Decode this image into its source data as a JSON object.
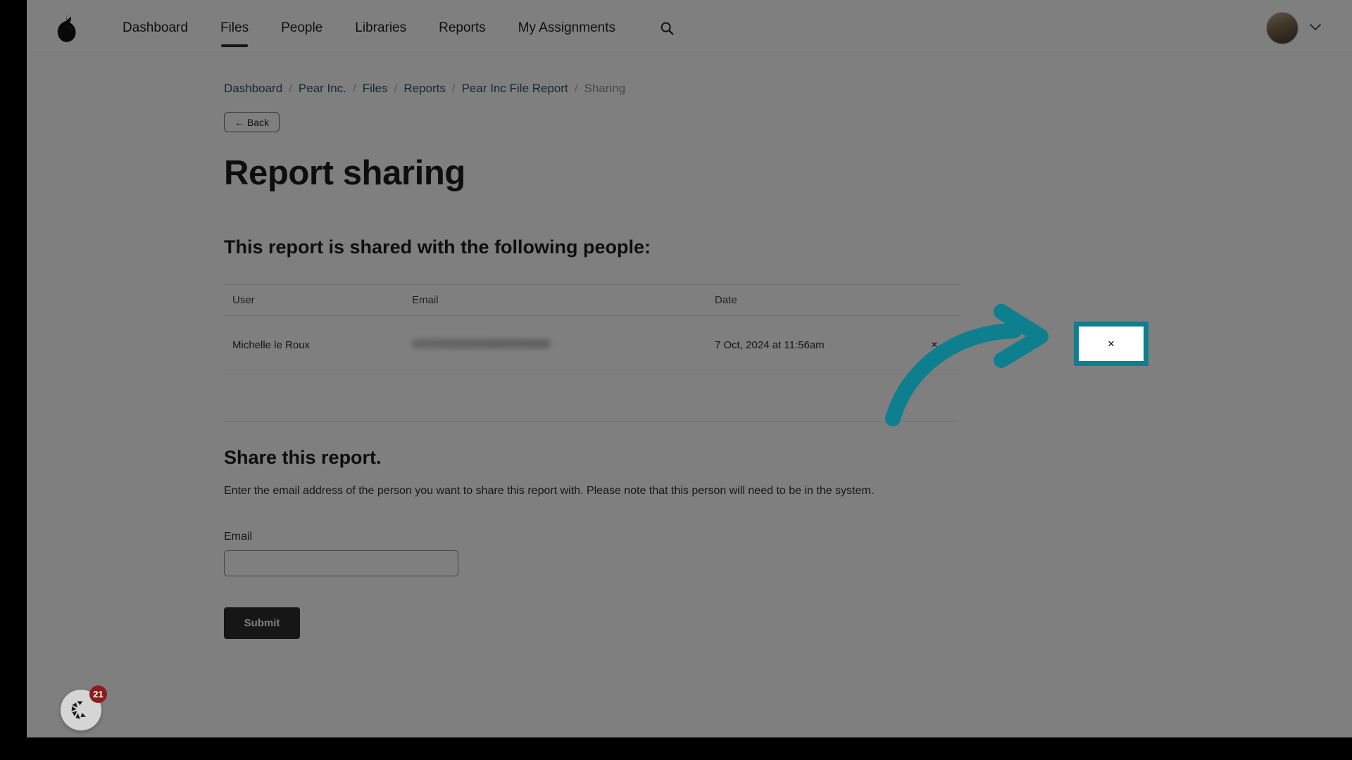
{
  "nav": {
    "logo_icon": "pear-logo-icon",
    "links": [
      {
        "label": "Dashboard",
        "active": false
      },
      {
        "label": "Files",
        "active": true
      },
      {
        "label": "People",
        "active": false
      },
      {
        "label": "Libraries",
        "active": false
      },
      {
        "label": "Reports",
        "active": false
      },
      {
        "label": "My Assignments",
        "active": false
      }
    ],
    "search_icon": "search-icon",
    "avatar_icon": "user-avatar",
    "account_chevron_icon": "chevron-down-icon"
  },
  "breadcrumb": {
    "separator": "/",
    "items": [
      {
        "label": "Dashboard",
        "current": false
      },
      {
        "label": "Pear Inc.",
        "current": false
      },
      {
        "label": "Files",
        "current": false
      },
      {
        "label": "Reports",
        "current": false
      },
      {
        "label": "Pear Inc File Report",
        "current": false
      },
      {
        "label": "Sharing",
        "current": true
      }
    ]
  },
  "back_button": {
    "label": "← Back"
  },
  "page_title": "Report sharing",
  "shared_section": {
    "heading": "This report is shared with the following people:",
    "columns": [
      "User",
      "Email",
      "Date",
      ""
    ],
    "rows": [
      {
        "user": "Michelle le Roux",
        "email": "",
        "date": "7 Oct, 2024 at 11:56am",
        "remove_label": "✕"
      }
    ]
  },
  "share_form": {
    "heading": "Share this report.",
    "description": "Enter the email address of the person you want to share this report with. Please note that this person will need to be in the system.",
    "email_label": "Email",
    "email_value": "",
    "email_placeholder": "",
    "submit_label": "Submit"
  },
  "helper_widget": {
    "icon": "helper-camera-icon",
    "badge_count": "21"
  },
  "annotation": {
    "arrow_icon": "curved-arrow-icon",
    "highlight_color": "#0d7f8e",
    "highlight_target": "remove-share-button"
  },
  "colors": {
    "accent_teal": "#0d7f8e",
    "link_teal": "#2e555d",
    "dark_button": "#2d2d2d",
    "badge_red": "#8e1b1b"
  }
}
